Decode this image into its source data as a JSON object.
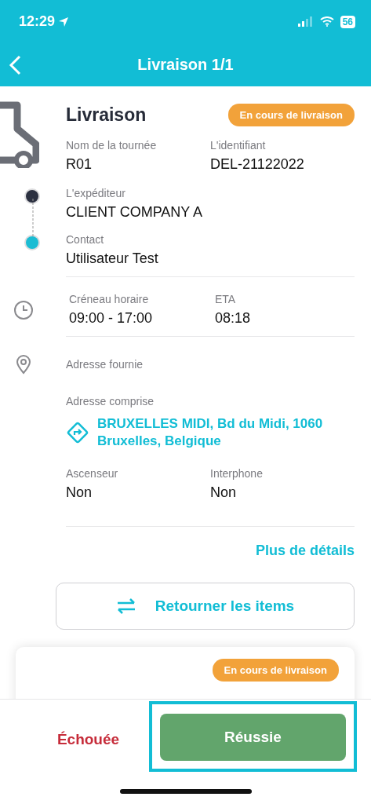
{
  "status_bar": {
    "time": "12:29",
    "battery": "56"
  },
  "header": {
    "title": "Livraison 1/1"
  },
  "delivery": {
    "title": "Livraison",
    "badge": "En cours de livraison",
    "route": {
      "label": "Nom de la tournée",
      "value": "R01"
    },
    "identifier": {
      "label": "L'identifiant",
      "value": "DEL-21122022"
    },
    "timeline": [
      {
        "label": "L'expéditeur",
        "value": "CLIENT COMPANY A",
        "color": "#2b3040"
      },
      {
        "label": "Contact",
        "value": "Utilisateur Test",
        "color": "#1bbcd3"
      }
    ],
    "slot": {
      "label": "Créneau horaire",
      "value": "09:00 - 17:00"
    },
    "eta": {
      "label": "ETA",
      "value": "08:18"
    },
    "provided_address": {
      "label": "Adresse fournie"
    },
    "understood_address": {
      "label": "Adresse comprise",
      "value": "BRUXELLES MIDI, Bd du Midi, 1060 Bruxelles, Belgique"
    },
    "elevator": {
      "label": "Ascenseur",
      "value": "Non"
    },
    "intercom": {
      "label": "Interphone",
      "value": "Non"
    },
    "more_link": "Plus de détails",
    "return_button": "Retourner les items"
  },
  "next_card": {
    "badge": "En cours de livraison"
  },
  "footer": {
    "failed": "Échouée",
    "success": "Réussie",
    "success_highlighted": true
  }
}
